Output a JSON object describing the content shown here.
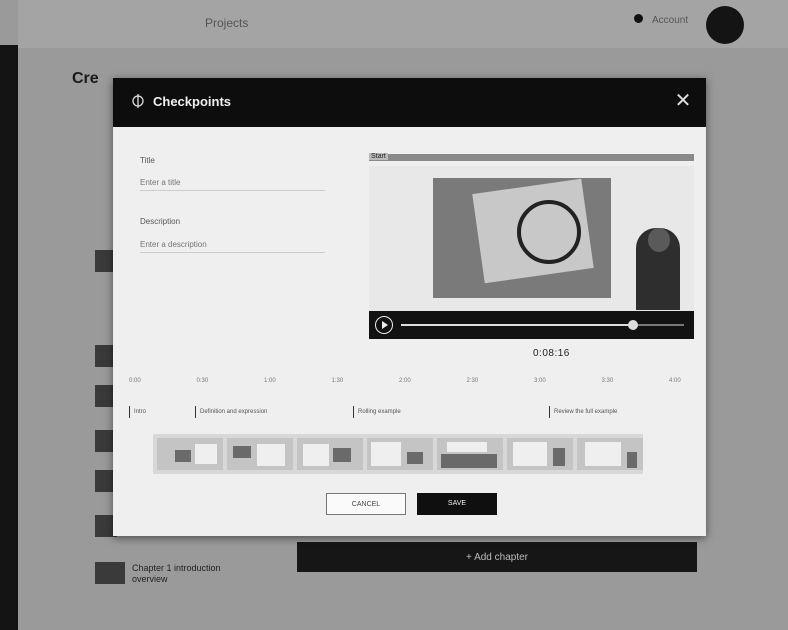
{
  "background": {
    "topbar_title": "Projects",
    "topbar_user": "Account",
    "heading": "Cre",
    "bottom_item_text": "Chapter 1 introduction overview",
    "add_button_label": "+ Add chapter"
  },
  "modal": {
    "title": "Checkpoints",
    "title_label": "Title",
    "title_placeholder": "Enter a title",
    "description_label": "Description",
    "description_placeholder": "Enter a description",
    "video_label": "Start",
    "timecode": "0:08:16",
    "progress": 0.82,
    "timeline_ticks": [
      "0:00",
      "0:30",
      "1:00",
      "1:30",
      "2:00",
      "2:30",
      "3:00",
      "3:30",
      "4:00"
    ],
    "chapters": [
      {
        "label": "Intro"
      },
      {
        "label": "Definition and expression"
      },
      {
        "label": "Rolling example"
      },
      {
        "label": "Review the full example"
      }
    ],
    "cancel_label": "CANCEL",
    "save_label": "SAVE"
  },
  "colors": {
    "header_bg": "#0d0d0d",
    "modal_bg": "#efefef",
    "save_bg": "#0f0f0f"
  }
}
